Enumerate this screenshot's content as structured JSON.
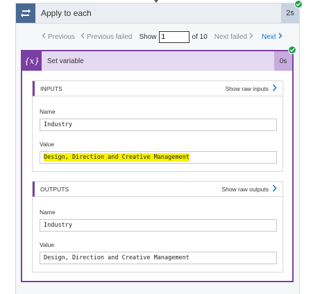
{
  "loop": {
    "title": "Apply to each",
    "duration": "2s"
  },
  "pager": {
    "previous": "Previous",
    "previous_failed": "Previous failed",
    "show_label": "Show",
    "current_page": "1",
    "of_label": "of 10",
    "next_failed": "Next failed",
    "next": "Next"
  },
  "action": {
    "icon_text": "{x}",
    "title": "Set variable",
    "duration": "0s"
  },
  "inputs": {
    "title": "INPUTS",
    "raw_link": "Show raw inputs",
    "name_label": "Name",
    "name_value": "Industry",
    "value_label": "Value",
    "value_value": "Design, Direction and Creative Management"
  },
  "outputs": {
    "title": "OUTPUTS",
    "raw_link": "Show raw outputs",
    "name_label": "Name",
    "name_value": "Industry",
    "value_label": "Value",
    "value_value": "Design, Direction and Creative Management"
  },
  "colors": {
    "loop_accent": "#486991",
    "action_accent": "#7a3fa3",
    "success": "#18a34a",
    "link": "#0078d4",
    "highlight": "#f6f200"
  },
  "icons": {
    "loop": "loop-arrows-icon",
    "success": "check-circle-icon",
    "variable": "variable-icon",
    "chevron_left": "chevron-left-icon",
    "chevron_right": "chevron-right-icon"
  }
}
